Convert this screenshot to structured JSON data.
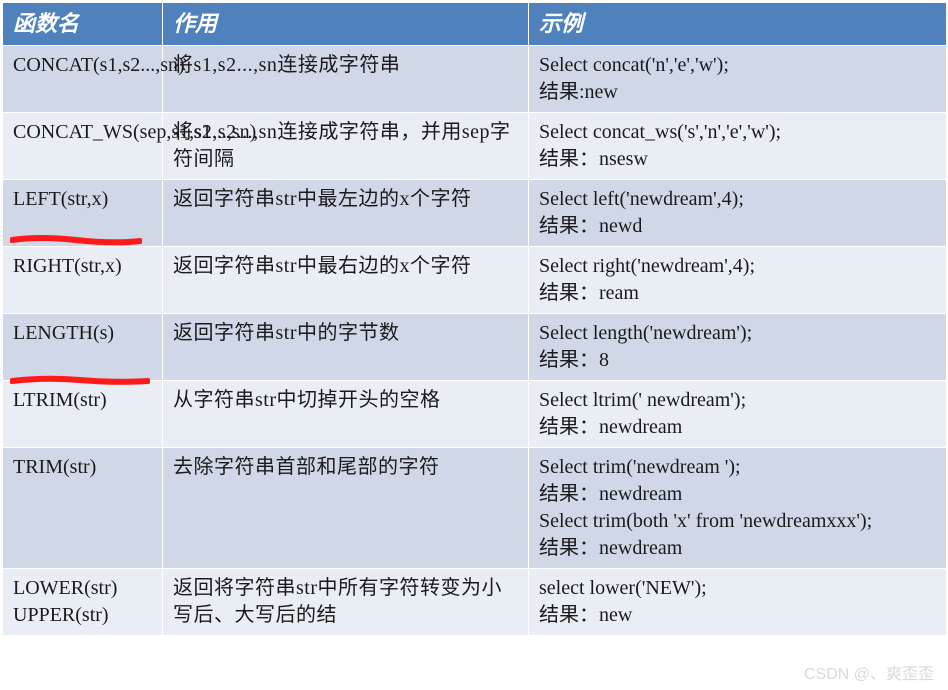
{
  "headers": {
    "col1": "函数名",
    "col2": "作用",
    "col3": "示例"
  },
  "rows": [
    {
      "fn": "CONCAT(s1,s2...,sn)",
      "desc": "将s1,s2...,sn连接成字符串",
      "example": "Select concat('n','e','w');\n结果:new"
    },
    {
      "fn": "CONCAT_WS(sep,s1,s2...,sn)",
      "desc": "将s1,s2...,sn连接成字符串，并用sep字符间隔",
      "example": "Select concat_ws('s','n','e','w');\n结果：nsesw"
    },
    {
      "fn": "LEFT(str,x)",
      "desc": "返回字符串str中最左边的x个字符",
      "example": "Select left('newdream',4);\n结果：newd"
    },
    {
      "fn": "RIGHT(str,x)",
      "desc": "返回字符串str中最右边的x个字符",
      "example": "Select right('newdream',4);\n结果：ream"
    },
    {
      "fn": "LENGTH(s)",
      "desc": "返回字符串str中的字节数",
      "example": "Select length('newdream');\n结果：8"
    },
    {
      "fn": "LTRIM(str)",
      "desc": "从字符串str中切掉开头的空格",
      "example": "Select ltrim('  newdream');\n结果：newdream"
    },
    {
      "fn": "TRIM(str)",
      "desc": "去除字符串首部和尾部的字符",
      "example": "Select trim('newdream  ');\n结果：newdream\nSelect trim(both 'x' from 'newdreamxxx');\n结果：newdream"
    },
    {
      "fn": "LOWER(str)\nUPPER(str)",
      "desc": "返回将字符串str中所有字符转变为小写后、大写后的结",
      "example": "select lower('NEW');\n结果：new"
    }
  ],
  "watermark": "CSDN @、爽歪歪"
}
